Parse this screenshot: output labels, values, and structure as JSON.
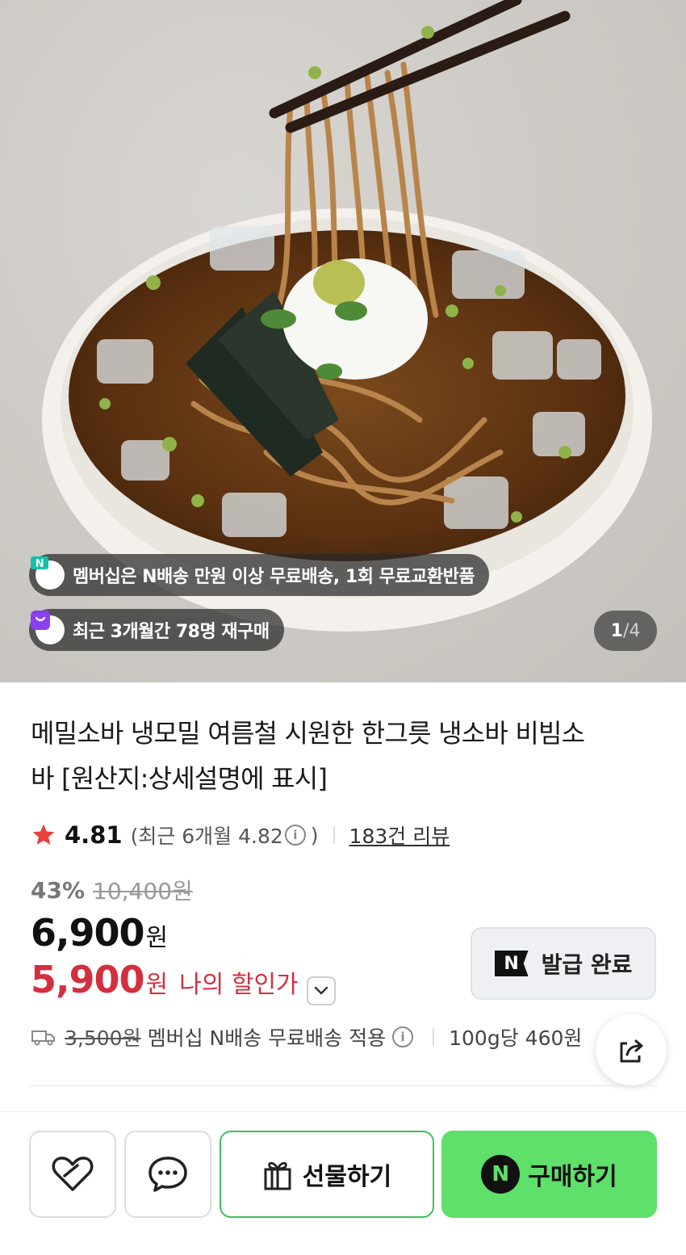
{
  "hero": {
    "membership_badge": "멤버십은 N배송 만원 이상 무료배송, 1회 무료교환반품",
    "repurchase_badge": "최근 3개월간 78명 재구매",
    "image_index": "1",
    "image_separator": "/",
    "image_total": "4"
  },
  "product": {
    "title": "메밀소바 냉모밀 여름철 시원한 한그릇 냉소바 비빔소바 [원산지:상세설명에 표시]",
    "rating": "4.81",
    "recent_rating_open": "(최근 6개월 4.82",
    "recent_rating_close": ")",
    "review_count": "183건 리뷰",
    "discount_rate": "43%",
    "original_price": "10,400원",
    "price": "6,900",
    "price_unit": "원",
    "my_price": "5,900",
    "my_price_unit": "원",
    "my_price_label": "나의 할인가",
    "coupon_logo": "N",
    "coupon_label": "발급 완료",
    "shipping_original": "3,500원",
    "shipping_text": "멤버십 N배송 무료배송 적용",
    "unit_price": "100g당 460원"
  },
  "bottom_bar": {
    "gift_label": "선물하기",
    "buy_logo": "N",
    "buy_label": "구매하기"
  },
  "colors": {
    "sale_red": "#d32f3f",
    "buy_green": "#5ee06a",
    "gift_border": "#3fc05a",
    "star_red": "#e8413a"
  },
  "icons": [
    "membership-n-icon",
    "repurchase-bag-icon",
    "star-icon",
    "info-icon",
    "truck-icon",
    "share-icon",
    "heart-icon",
    "chat-icon",
    "gift-icon"
  ]
}
